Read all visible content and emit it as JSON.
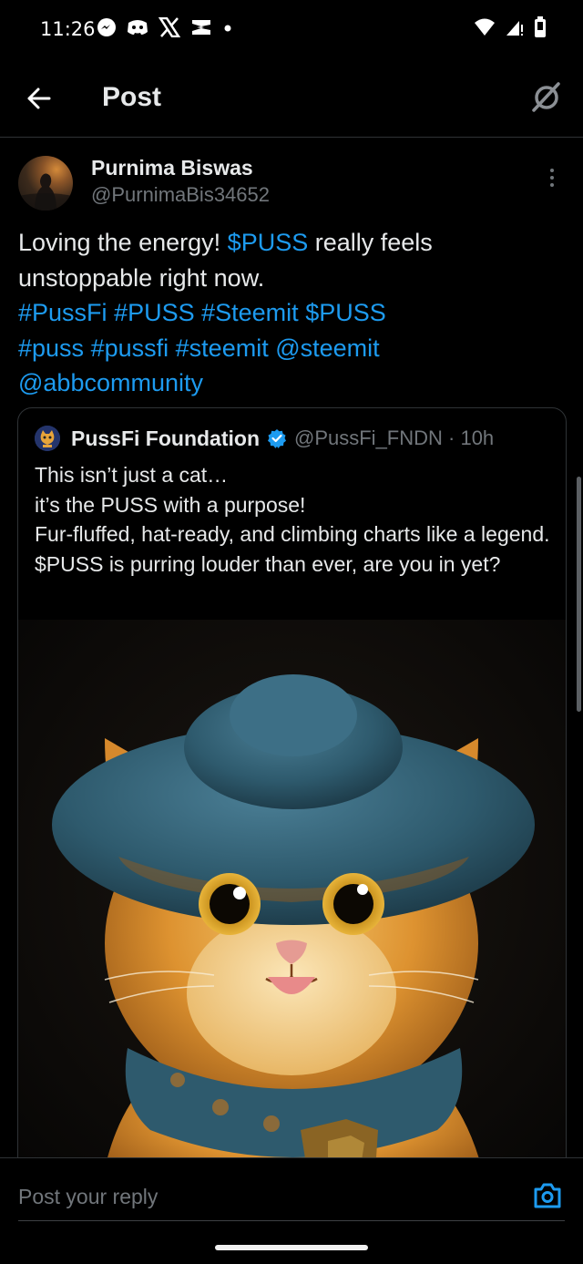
{
  "status_bar": {
    "time": "11:26",
    "left_icons": [
      "messenger-icon",
      "discord-icon",
      "x-icon",
      "capcut-icon",
      "dot-icon"
    ],
    "right_icons": [
      "wifi-icon",
      "signal-icon",
      "battery-icon"
    ]
  },
  "header": {
    "title": "Post",
    "back_icon": "arrow-left-icon",
    "grok_icon": "grok-icon"
  },
  "post": {
    "author_name": "Purnima Biswas",
    "author_handle": "@PurnimaBis34652",
    "text_1": "Loving the energy! ",
    "cashtag_1": "$PUSS",
    "text_2": " really feels unstoppable right now.",
    "tags": [
      "#PussFi",
      "#PUSS",
      "#Steemit",
      "$PUSS",
      "#puss",
      "#pussfi",
      "#steemit",
      "@steemit",
      "@abbcommunity"
    ]
  },
  "quote": {
    "author_name": "PussFi Foundation",
    "handle_time": "@PussFi_FNDN · 10h",
    "text": "This isn’t just a cat…\n it’s the PUSS with a purpose!\nFur-fluffed, hat-ready, and climbing charts like a legend.\n$PUSS is purring louder than ever, are you in yet?",
    "image_alt": "cat-in-blue-hat-image"
  },
  "reply": {
    "placeholder": "Post your reply",
    "camera_icon": "camera-icon"
  },
  "colors": {
    "background": "#000000",
    "text": "#e7e9ea",
    "muted": "#71767b",
    "link": "#1d9bf0",
    "border": "#2f3336"
  }
}
